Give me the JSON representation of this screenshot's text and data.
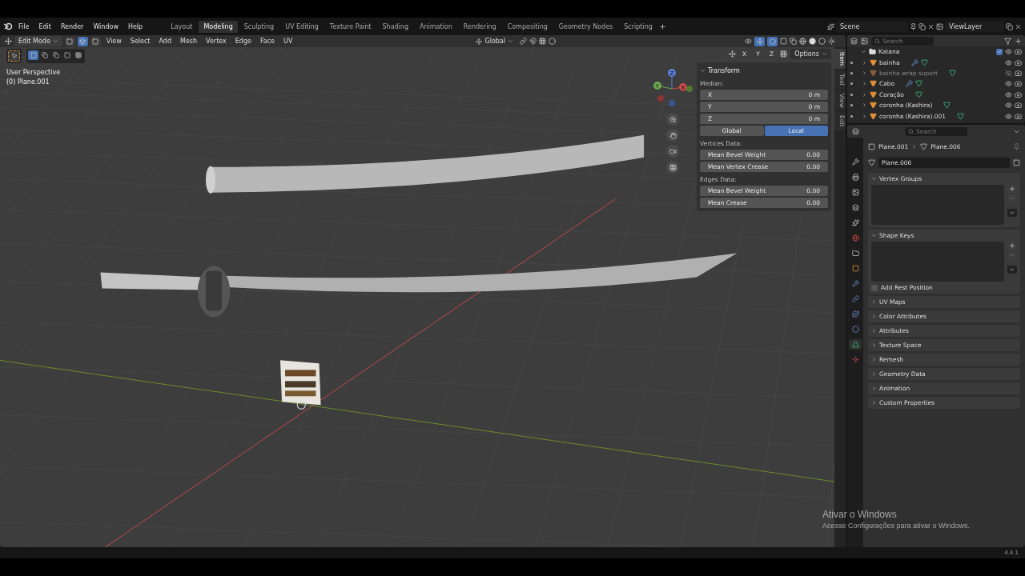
{
  "menu": [
    "File",
    "Edit",
    "Render",
    "Window",
    "Help"
  ],
  "workspaces": [
    {
      "label": "Layout",
      "selected": false
    },
    {
      "label": "Modeling",
      "selected": true
    },
    {
      "label": "Sculpting",
      "selected": false
    },
    {
      "label": "UV Editing",
      "selected": false
    },
    {
      "label": "Texture Paint",
      "selected": false
    },
    {
      "label": "Shading",
      "selected": false
    },
    {
      "label": "Animation",
      "selected": false
    },
    {
      "label": "Rendering",
      "selected": false
    },
    {
      "label": "Compositing",
      "selected": false
    },
    {
      "label": "Geometry Nodes",
      "selected": false
    },
    {
      "label": "Scripting",
      "selected": false
    }
  ],
  "scene": "Scene",
  "view_layer": "ViewLayer",
  "viewport": {
    "mode": "Edit Mode",
    "select_modes": [
      {
        "kind": "vertex",
        "selected": false
      },
      {
        "kind": "edge",
        "selected": true
      },
      {
        "kind": "face",
        "selected": false
      }
    ],
    "menus": [
      "View",
      "Select",
      "Add",
      "Mesh",
      "Vertex",
      "Edge",
      "Face",
      "UV"
    ],
    "orientation": "Global",
    "mirror_axes": [
      "X",
      "Y",
      "Z"
    ],
    "options": "Options",
    "view_name": "User Perspective",
    "object_name": "(0) Plane.001",
    "gizmo": [
      "Z",
      "Y",
      "X"
    ]
  },
  "sidebar": {
    "tabs": [
      {
        "label": "Item",
        "selected": true
      },
      {
        "label": "Tool",
        "selected": false
      },
      {
        "label": "View",
        "selected": false
      },
      {
        "label": "Edit",
        "selected": false
      }
    ],
    "panel": "Transform",
    "expanded": true,
    "median_label": "Median:",
    "median": [
      {
        "label": "X",
        "value": "0 m"
      },
      {
        "label": "Y",
        "value": "0 m"
      },
      {
        "label": "Z",
        "value": "0 m"
      }
    ],
    "space": [
      {
        "label": "Global",
        "selected": false
      },
      {
        "label": "Local",
        "selected": true
      }
    ],
    "vertices_label": "Vertices Data:",
    "vertices": [
      {
        "label": "Mean Bevel Weight",
        "value": "0.00"
      },
      {
        "label": "Mean Vertex Crease",
        "value": "0.00"
      }
    ],
    "edges_label": "Edges Data:",
    "edges": [
      {
        "label": "Mean Bevel Weight",
        "value": "0.00"
      },
      {
        "label": "Mean Crease",
        "value": "0.00"
      }
    ]
  },
  "outliner": {
    "placeholder": "Search",
    "collection": {
      "name": "Katana",
      "expanded": true,
      "checked": true
    },
    "items": [
      {
        "name": "bainha",
        "modifier": true,
        "hidden": false
      },
      {
        "name": "bainha wrap suport",
        "modifier": false,
        "hidden": true
      },
      {
        "name": "Cabo",
        "modifier": true,
        "hidden": false
      },
      {
        "name": "Coração",
        "modifier": false,
        "hidden": false
      },
      {
        "name": "coronha (Kashira)",
        "modifier": false,
        "hidden": false
      },
      {
        "name": "coronha (Kashira).001",
        "modifier": false,
        "hidden": false
      }
    ]
  },
  "properties": {
    "placeholder": "Search",
    "breadcrumb": [
      "Plane.001",
      "Plane.006"
    ],
    "mesh_name": "Plane.006",
    "tabs": [
      {
        "kind": "tool",
        "selected": false
      },
      {
        "kind": "render",
        "selected": false
      },
      {
        "kind": "output",
        "selected": false
      },
      {
        "kind": "view_layer",
        "selected": false
      },
      {
        "kind": "scene",
        "selected": false
      },
      {
        "kind": "world",
        "selected": false
      },
      {
        "kind": "collection",
        "selected": false
      },
      {
        "kind": "object",
        "selected": false
      },
      {
        "kind": "modifier",
        "selected": false
      },
      {
        "kind": "particles",
        "selected": false
      },
      {
        "kind": "physics",
        "selected": false
      },
      {
        "kind": "constraints",
        "selected": false
      },
      {
        "kind": "data",
        "selected": true
      },
      {
        "kind": "material",
        "selected": false
      }
    ],
    "panels": [
      {
        "title": "Vertex Groups",
        "expanded": true,
        "kind": "list"
      },
      {
        "title": "Shape Keys",
        "expanded": true,
        "kind": "list",
        "checkbox": {
          "label": "Add Rest Position",
          "checked": false
        }
      },
      {
        "title": "UV Maps",
        "expanded": false
      },
      {
        "title": "Color Attributes",
        "expanded": false
      },
      {
        "title": "Attributes",
        "expanded": false
      },
      {
        "title": "Texture Space",
        "expanded": false
      },
      {
        "title": "Remesh",
        "expanded": false
      },
      {
        "title": "Geometry Data",
        "expanded": false
      },
      {
        "title": "Animation",
        "expanded": false
      },
      {
        "title": "Custom Properties",
        "expanded": false
      }
    ]
  },
  "activation_notice": [
    "Ativar o Windows",
    "Acesse Configurações para ativar o Windows."
  ],
  "version": "4.4.1"
}
